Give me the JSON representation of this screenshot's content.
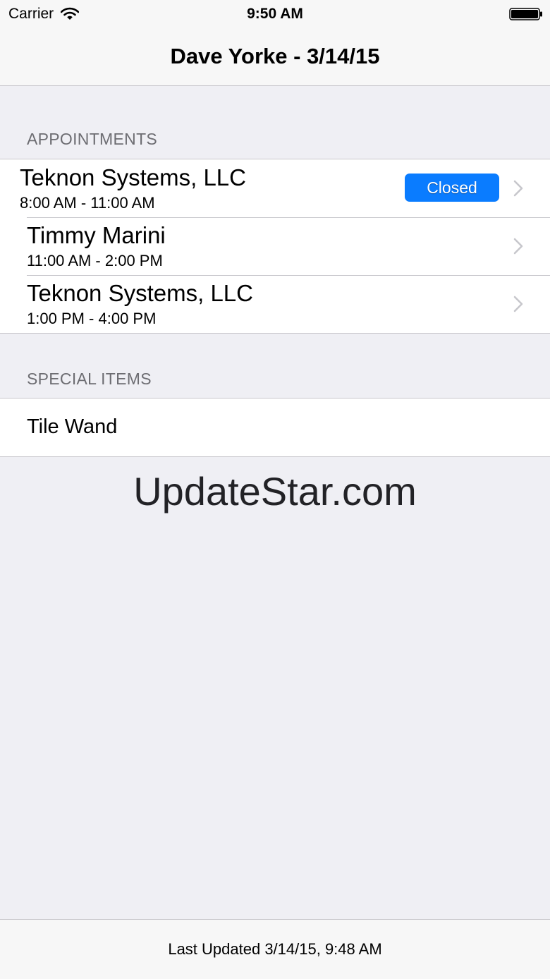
{
  "status_bar": {
    "carrier": "Carrier",
    "time": "9:50 AM",
    "wifi_icon": "wifi-icon",
    "battery_icon": "battery-icon"
  },
  "nav": {
    "title": "Dave Yorke - 3/14/15"
  },
  "appointments": {
    "header": "APPOINTMENTS",
    "items": [
      {
        "title": "Teknon Systems, LLC",
        "time": "8:00 AM - 11:00 AM",
        "badge": "Closed",
        "badge_color": "#0a7cff"
      },
      {
        "title": "Timmy Marini",
        "time": "11:00 AM - 2:00 PM"
      },
      {
        "title": "Teknon Systems, LLC",
        "time": "1:00 PM - 4:00 PM"
      }
    ]
  },
  "special_items": {
    "header": "SPECIAL ITEMS",
    "items": [
      {
        "label": "Tile Wand"
      }
    ]
  },
  "watermark": "UpdateStar.com",
  "toolbar": {
    "last_updated": "Last Updated 3/14/15, 9:48 AM"
  },
  "colors": {
    "background": "#efeff4",
    "bar_background": "#f7f7f7",
    "separator": "#c8c7cc",
    "section_header": "#6d6d72",
    "accent": "#0a7cff",
    "chevron": "#c7c7cc"
  }
}
